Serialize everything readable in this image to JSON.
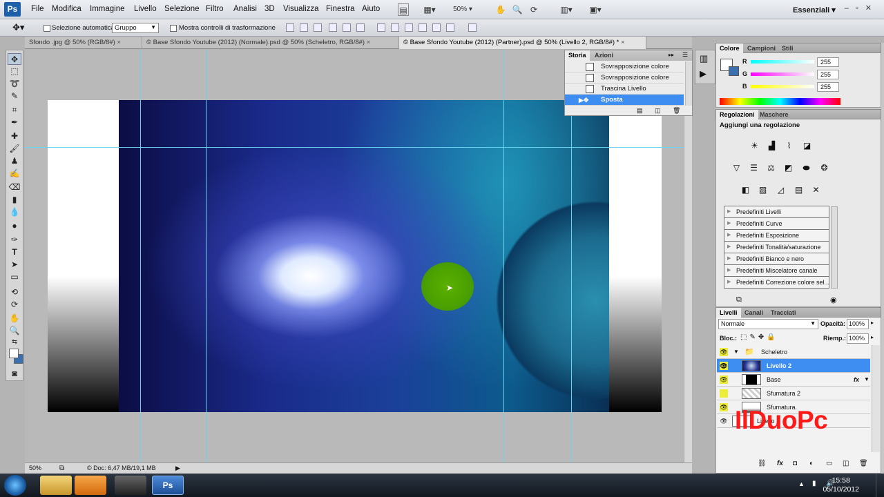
{
  "app": {
    "logo": "Ps"
  },
  "menu": [
    "File",
    "Modifica",
    "Immagine",
    "Livello",
    "Selezione",
    "Filtro",
    "Analisi",
    "3D",
    "Visualizza",
    "Finestra",
    "Aiuto"
  ],
  "topbar": {
    "zoom": "50%",
    "workspace": "Essenziali",
    "tool_glyphs": [
      "✋",
      "🔍",
      "⟳"
    ]
  },
  "options": {
    "auto_select_label": "Selezione automatica:",
    "auto_select_value": "Gruppo",
    "transform_label": "Mostra controlli di trasformazione"
  },
  "tabs": [
    {
      "label": "Sfondo .jpg @ 50% (RGB/8#)",
      "close": "×"
    },
    {
      "label": "© Base Sfondo Youtube (2012) (Normale).psd @ 50% (Scheletro, RGB/8#)",
      "close": "×"
    },
    {
      "label": "© Base Sfondo Youtube (2012) (Partner).psd @ 50% (Livello 2, RGB/8#) *",
      "close": "×"
    }
  ],
  "history": {
    "tabs": [
      "Storia",
      "Azioni"
    ],
    "items": [
      "Sovrapposizione colore",
      "Sovrapposizione colore",
      "Trascina Livello",
      "Sposta"
    ],
    "selected": "Sposta"
  },
  "color_panel": {
    "tabs": [
      "Colore",
      "Campioni",
      "Stili"
    ],
    "r": "255",
    "g": "255",
    "b": "255",
    "r_label": "R",
    "g_label": "G",
    "b_label": "B"
  },
  "adjustments": {
    "tabs": [
      "Regolazioni",
      "Maschere"
    ],
    "title": "Aggiungi una regolazione",
    "presets": [
      "Predefiniti Livelli",
      "Predefiniti Curve",
      "Predefiniti Esposizione",
      "Predefiniti Tonalità/saturazione",
      "Predefiniti Bianco e nero",
      "Predefiniti Miscelatore canale",
      "Predefiniti Correzione colore sel..."
    ]
  },
  "layers_panel": {
    "tabs": [
      "Livelli",
      "Canali",
      "Tracciati"
    ],
    "blend_mode": "Normale",
    "opacity_label": "Opacità:",
    "opacity": "100%",
    "fill_label": "Riemp.:",
    "fill": "100%",
    "lock_label": "Bloc.:",
    "layers": [
      {
        "name": "Scheletro",
        "type": "group",
        "visible": true
      },
      {
        "name": "Livello 2",
        "selected": true,
        "visible": true
      },
      {
        "name": "Base",
        "fx": "fx",
        "visible": true
      },
      {
        "name": "Sfumatura 2",
        "visible": false
      },
      {
        "name": "Sfumatura.",
        "visible": true
      },
      {
        "name": "Livello 1",
        "visible": true
      }
    ]
  },
  "status": {
    "zoom": "50%",
    "doc_info": "© Doc: 6,47 MB/19,1 MB"
  },
  "watermark": "IlDuoPc",
  "clock": {
    "time": "15:58",
    "date": "05/10/2012"
  }
}
